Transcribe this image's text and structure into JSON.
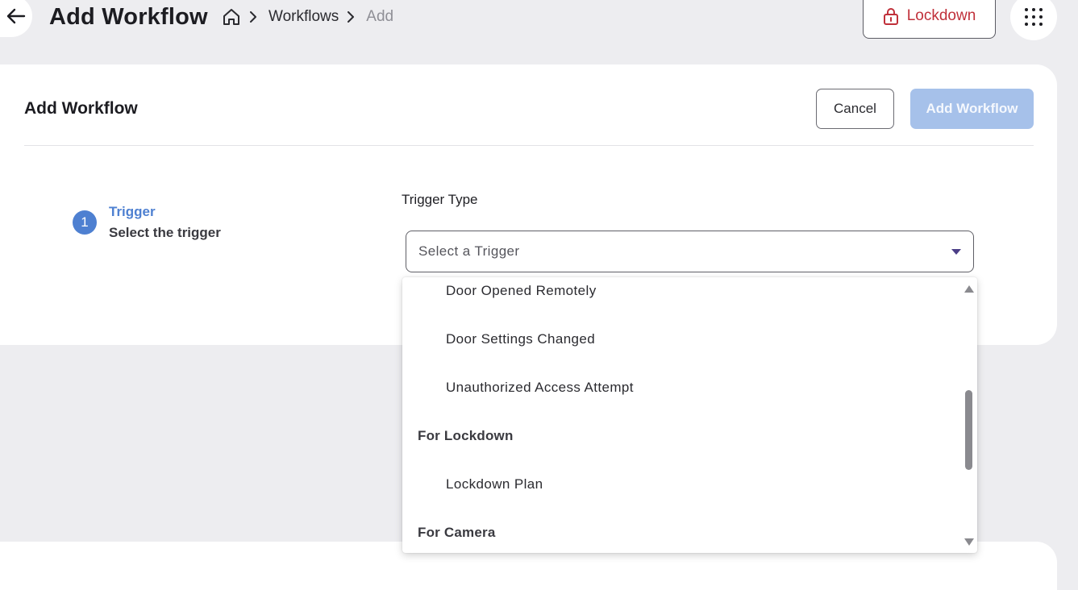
{
  "header": {
    "title": "Add Workflow",
    "breadcrumb": [
      "Workflows",
      "Add"
    ],
    "lockdown_label": "Lockdown"
  },
  "card": {
    "title": "Add Workflow",
    "cancel_label": "Cancel",
    "add_label": "Add Workflow"
  },
  "step": {
    "number": "1",
    "title": "Trigger",
    "subtitle": "Select the trigger"
  },
  "trigger": {
    "label": "Trigger Type",
    "placeholder": "Select a Trigger"
  },
  "dropdown": {
    "items": [
      {
        "text": "Door Opened Remotely",
        "kind": "option"
      },
      {
        "text": "Door Settings Changed",
        "kind": "option"
      },
      {
        "text": "Unauthorized Access Attempt",
        "kind": "option"
      },
      {
        "text": "For Lockdown",
        "kind": "group"
      },
      {
        "text": "Lockdown Plan",
        "kind": "option"
      },
      {
        "text": "For Camera",
        "kind": "group"
      }
    ]
  },
  "colors": {
    "accent": "#4e80d1",
    "primary_disabled": "#a6c1ea",
    "lockdown": "#c0303a",
    "background": "#ededf0"
  }
}
